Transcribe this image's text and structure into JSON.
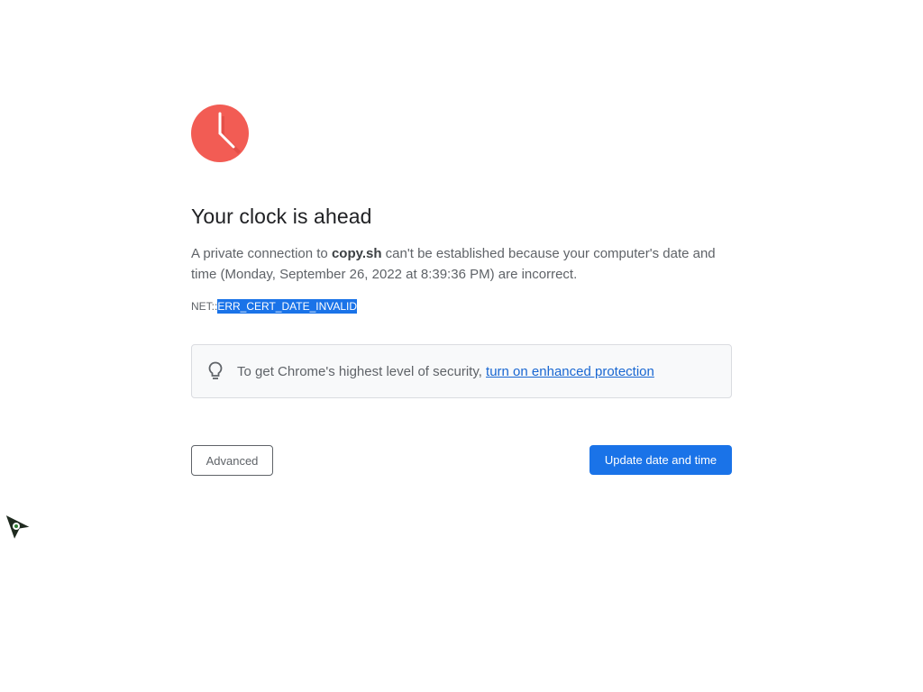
{
  "heading": "Your clock is ahead",
  "explanation": {
    "prefix": "A private connection to ",
    "host": "copy.sh",
    "suffix": " can't be established because your computer's date and time (Monday, September 26, 2022 at 8:39:36 PM) are incorrect."
  },
  "error_code": {
    "prefix": "NET::",
    "code": "ERR_CERT_DATE_INVALID"
  },
  "security_tip": {
    "text": "To get Chrome's highest level of security, ",
    "link": "turn on enhanced protection"
  },
  "buttons": {
    "advanced": "Advanced",
    "primary": "Update date and time"
  },
  "colors": {
    "clock_red": "#f25c54",
    "primary_blue": "#1a73e8",
    "link_blue": "#1967d2"
  },
  "icons": {
    "main": "clock-icon",
    "tip": "lightbulb-icon",
    "pointer": "mouse-cursor-icon"
  }
}
